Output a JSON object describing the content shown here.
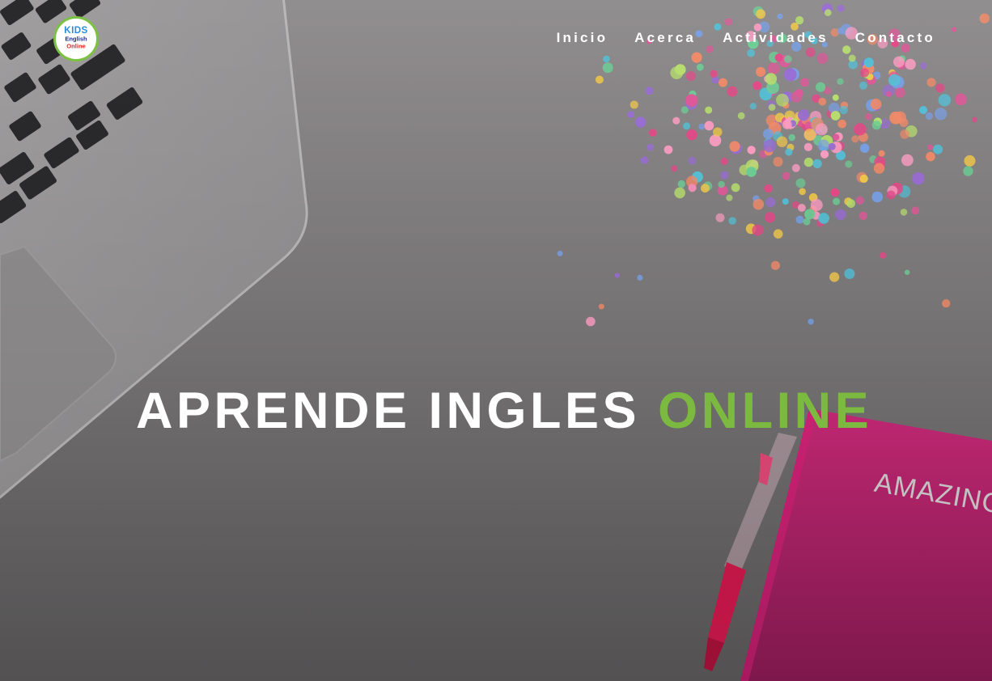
{
  "logo": {
    "line1": "KIDS",
    "line2": "English",
    "line3": "Online",
    "icon": "kids-english-online-logo"
  },
  "nav": {
    "items": [
      {
        "label": "Inicio"
      },
      {
        "label": "Acerca"
      },
      {
        "label": "Actividades"
      },
      {
        "label": "Contacto"
      }
    ]
  },
  "hero": {
    "title_main": "APRENDE INGLES",
    "title_accent": "ONLINE",
    "notebook_text": "AMAZING",
    "accent_color": "#7cb940",
    "notebook_color": "#e0136f"
  }
}
